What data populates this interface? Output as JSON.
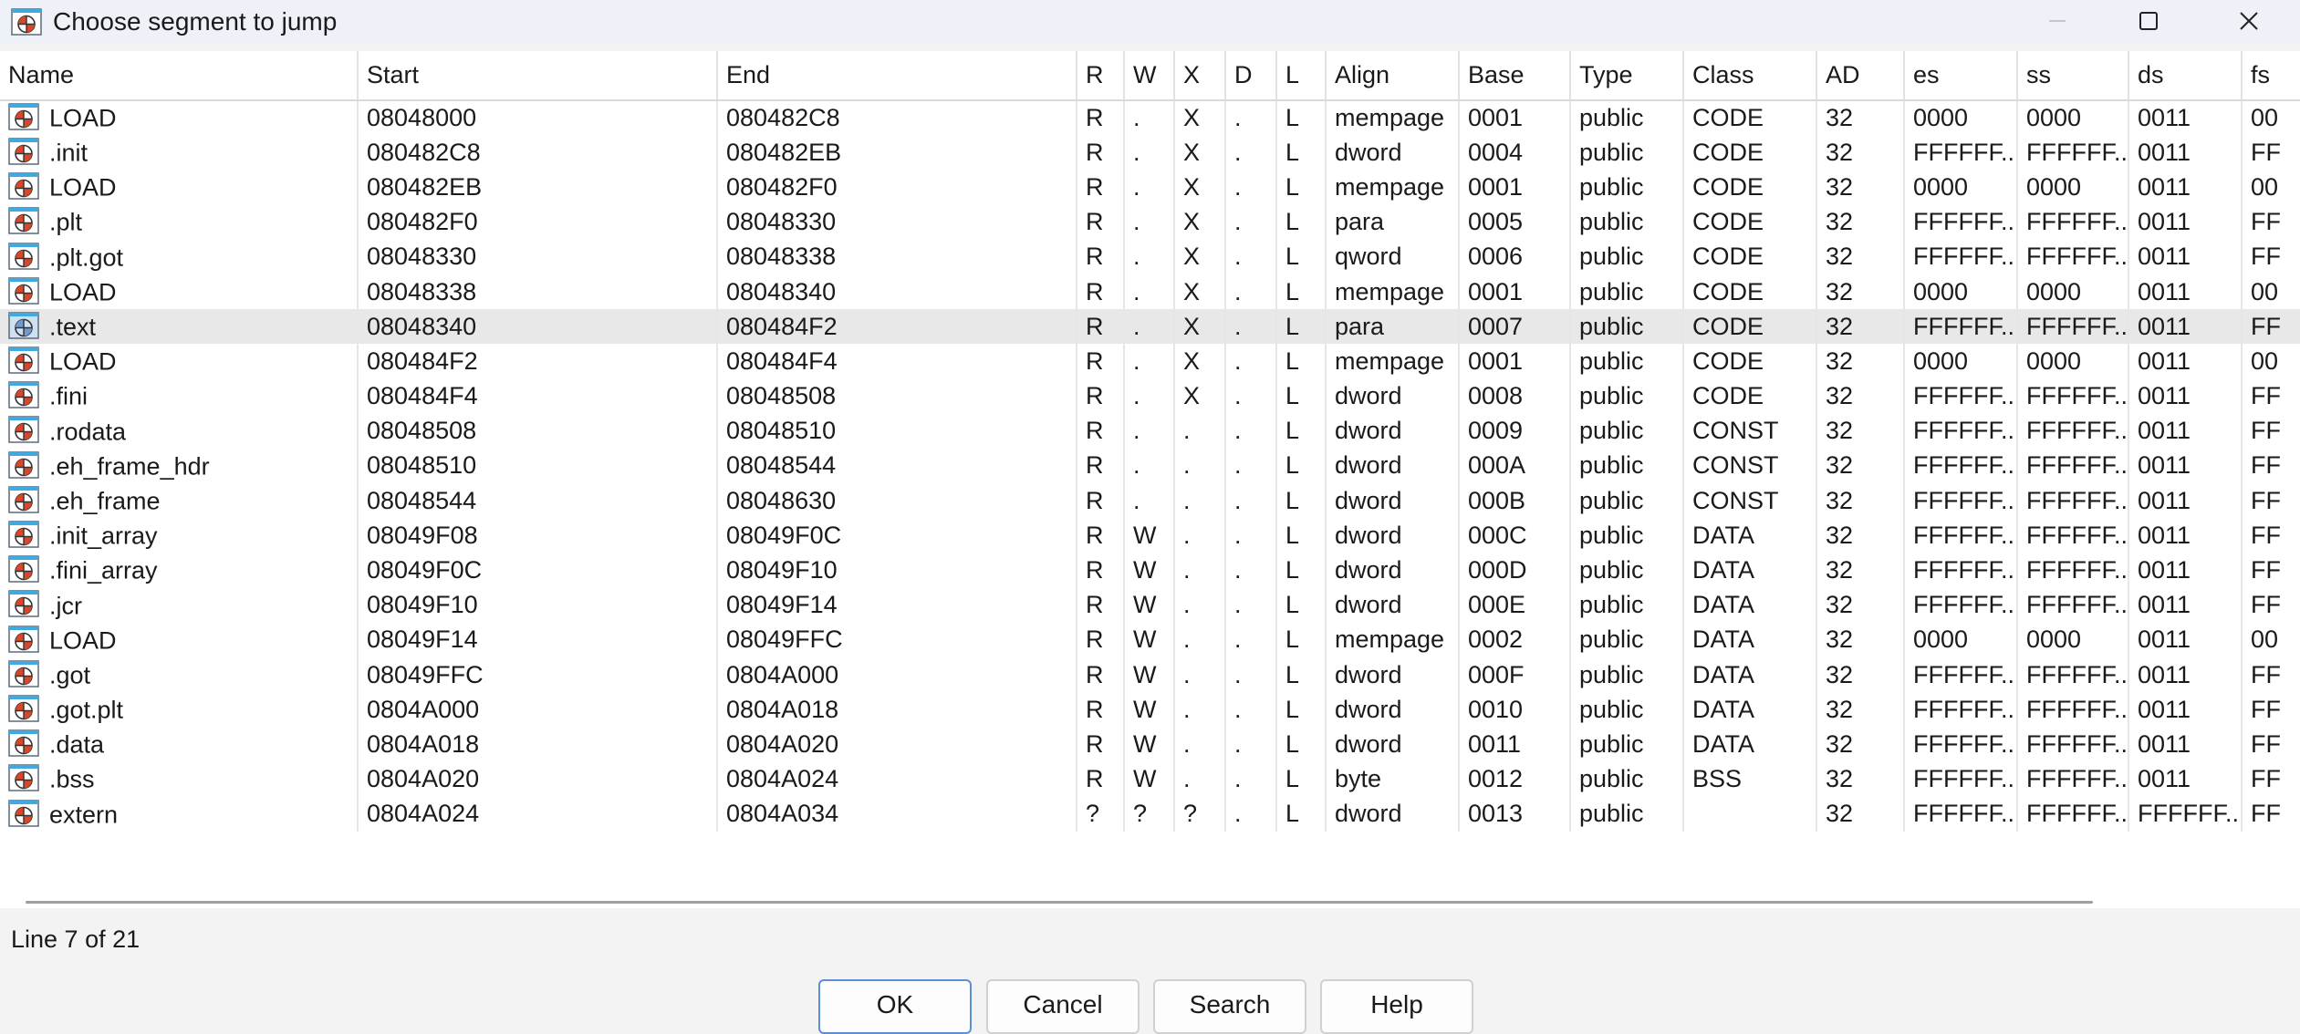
{
  "window": {
    "title": "Choose segment to jump"
  },
  "table": {
    "columns": [
      "Name",
      "Start",
      "End",
      "R",
      "W",
      "X",
      "D",
      "L",
      "Align",
      "Base",
      "Type",
      "Class",
      "AD",
      "es",
      "ss",
      "ds",
      "fs"
    ],
    "rows": [
      [
        "LOAD",
        "08048000",
        "080482C8",
        "R",
        ".",
        "X",
        ".",
        "L",
        "mempage",
        "0001",
        "public",
        "CODE",
        "32",
        "0000",
        "0000",
        "0011",
        "00"
      ],
      [
        ".init",
        "080482C8",
        "080482EB",
        "R",
        ".",
        "X",
        ".",
        "L",
        "dword",
        "0004",
        "public",
        "CODE",
        "32",
        "FFFFFF...",
        "FFFFFF...",
        "0011",
        "FF"
      ],
      [
        "LOAD",
        "080482EB",
        "080482F0",
        "R",
        ".",
        "X",
        ".",
        "L",
        "mempage",
        "0001",
        "public",
        "CODE",
        "32",
        "0000",
        "0000",
        "0011",
        "00"
      ],
      [
        ".plt",
        "080482F0",
        "08048330",
        "R",
        ".",
        "X",
        ".",
        "L",
        "para",
        "0005",
        "public",
        "CODE",
        "32",
        "FFFFFF...",
        "FFFFFF...",
        "0011",
        "FF"
      ],
      [
        ".plt.got",
        "08048330",
        "08048338",
        "R",
        ".",
        "X",
        ".",
        "L",
        "qword",
        "0006",
        "public",
        "CODE",
        "32",
        "FFFFFF...",
        "FFFFFF...",
        "0011",
        "FF"
      ],
      [
        "LOAD",
        "08048338",
        "08048340",
        "R",
        ".",
        "X",
        ".",
        "L",
        "mempage",
        "0001",
        "public",
        "CODE",
        "32",
        "0000",
        "0000",
        "0011",
        "00"
      ],
      [
        ".text",
        "08048340",
        "080484F2",
        "R",
        ".",
        "X",
        ".",
        "L",
        "para",
        "0007",
        "public",
        "CODE",
        "32",
        "FFFFFF...",
        "FFFFFF...",
        "0011",
        "FF"
      ],
      [
        "LOAD",
        "080484F2",
        "080484F4",
        "R",
        ".",
        "X",
        ".",
        "L",
        "mempage",
        "0001",
        "public",
        "CODE",
        "32",
        "0000",
        "0000",
        "0011",
        "00"
      ],
      [
        ".fini",
        "080484F4",
        "08048508",
        "R",
        ".",
        "X",
        ".",
        "L",
        "dword",
        "0008",
        "public",
        "CODE",
        "32",
        "FFFFFF...",
        "FFFFFF...",
        "0011",
        "FF"
      ],
      [
        ".rodata",
        "08048508",
        "08048510",
        "R",
        ".",
        ".",
        ".",
        "L",
        "dword",
        "0009",
        "public",
        "CONST",
        "32",
        "FFFFFF...",
        "FFFFFF...",
        "0011",
        "FF"
      ],
      [
        ".eh_frame_hdr",
        "08048510",
        "08048544",
        "R",
        ".",
        ".",
        ".",
        "L",
        "dword",
        "000A",
        "public",
        "CONST",
        "32",
        "FFFFFF...",
        "FFFFFF...",
        "0011",
        "FF"
      ],
      [
        ".eh_frame",
        "08048544",
        "08048630",
        "R",
        ".",
        ".",
        ".",
        "L",
        "dword",
        "000B",
        "public",
        "CONST",
        "32",
        "FFFFFF...",
        "FFFFFF...",
        "0011",
        "FF"
      ],
      [
        ".init_array",
        "08049F08",
        "08049F0C",
        "R",
        "W",
        ".",
        ".",
        "L",
        "dword",
        "000C",
        "public",
        "DATA",
        "32",
        "FFFFFF...",
        "FFFFFF...",
        "0011",
        "FF"
      ],
      [
        ".fini_array",
        "08049F0C",
        "08049F10",
        "R",
        "W",
        ".",
        ".",
        "L",
        "dword",
        "000D",
        "public",
        "DATA",
        "32",
        "FFFFFF...",
        "FFFFFF...",
        "0011",
        "FF"
      ],
      [
        ".jcr",
        "08049F10",
        "08049F14",
        "R",
        "W",
        ".",
        ".",
        "L",
        "dword",
        "000E",
        "public",
        "DATA",
        "32",
        "FFFFFF...",
        "FFFFFF...",
        "0011",
        "FF"
      ],
      [
        "LOAD",
        "08049F14",
        "08049FFC",
        "R",
        "W",
        ".",
        ".",
        "L",
        "mempage",
        "0002",
        "public",
        "DATA",
        "32",
        "0000",
        "0000",
        "0011",
        "00"
      ],
      [
        ".got",
        "08049FFC",
        "0804A000",
        "R",
        "W",
        ".",
        ".",
        "L",
        "dword",
        "000F",
        "public",
        "DATA",
        "32",
        "FFFFFF...",
        "FFFFFF...",
        "0011",
        "FF"
      ],
      [
        ".got.plt",
        "0804A000",
        "0804A018",
        "R",
        "W",
        ".",
        ".",
        "L",
        "dword",
        "0010",
        "public",
        "DATA",
        "32",
        "FFFFFF...",
        "FFFFFF...",
        "0011",
        "FF"
      ],
      [
        ".data",
        "0804A018",
        "0804A020",
        "R",
        "W",
        ".",
        ".",
        "L",
        "dword",
        "0011",
        "public",
        "DATA",
        "32",
        "FFFFFF...",
        "FFFFFF...",
        "0011",
        "FF"
      ],
      [
        ".bss",
        "0804A020",
        "0804A024",
        "R",
        "W",
        ".",
        ".",
        "L",
        "byte",
        "0012",
        "public",
        "BSS",
        "32",
        "FFFFFF...",
        "FFFFFF...",
        "0011",
        "FF"
      ],
      [
        "extern",
        "0804A024",
        "0804A034",
        "?",
        "?",
        "?",
        ".",
        "L",
        "dword",
        "0013",
        "public",
        "",
        "32",
        "FFFFFF...",
        "FFFFFF...",
        "FFFFFF...",
        "FF"
      ]
    ]
  },
  "status": {
    "line": "Line 7 of 21"
  },
  "buttons": {
    "ok": "OK",
    "cancel": "Cancel",
    "search": "Search",
    "help": "Help"
  },
  "icons": {
    "app": "segment-icon",
    "row": "segment-icon",
    "minimize": "minimize-icon",
    "maximize": "maximize-icon",
    "close": "close-icon"
  },
  "colors": {
    "title_bar": "#eef1f8",
    "selection": "#e8e8e8",
    "ok_border": "#5b8fd6",
    "icon_red": "#d9472b"
  }
}
